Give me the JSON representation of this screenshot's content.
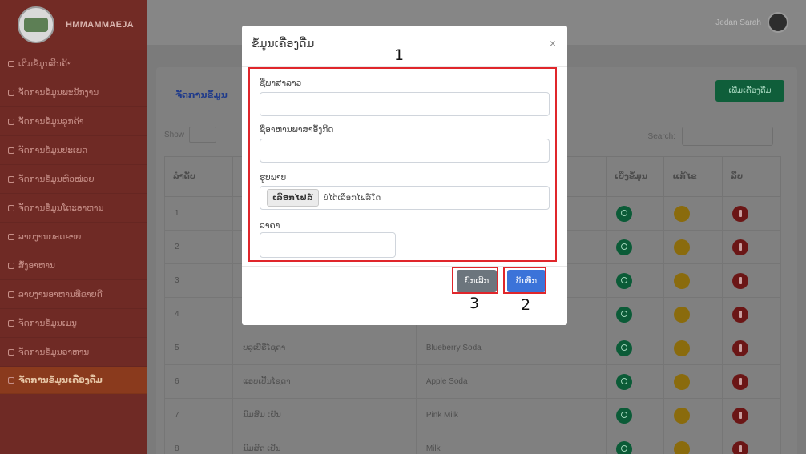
{
  "sidebar": {
    "brand": "HMMAMMAEJA",
    "items": [
      {
        "label": "ເຕີມຂໍ້ມູນສິນຄ້າ",
        "active": false
      },
      {
        "label": "ຈັດການຂໍ້ມູນພະນັກງານ",
        "active": false
      },
      {
        "label": "ຈັດການຂໍ້ມູນລູກຄ້າ",
        "active": false
      },
      {
        "label": "ຈັດການຂໍ້ມູນປະເພດ",
        "active": false
      },
      {
        "label": "ຈັດການຂໍ້ມູນຫົວໜ່ວຍ",
        "active": false
      },
      {
        "label": "ຈັດການຂໍ້ມູນໂຕະອາຫານ",
        "active": false
      },
      {
        "label": "ລາຍງານຍອດຂາຍ",
        "active": false
      },
      {
        "label": "ສັ່ງອາຫານ",
        "active": false
      },
      {
        "label": "ລາຍງານອາຫານທີ່ຂາຍດີ",
        "active": false
      },
      {
        "label": "ຈັດການຂໍ້ມູນເມນູ",
        "active": false
      },
      {
        "label": "ຈັດການຂໍ້ມູນອາຫານ",
        "active": false
      },
      {
        "label": "ຈັດການຂໍ້ມູນເຄື່ອງດື່ມ",
        "active": true
      }
    ]
  },
  "topbar": {
    "user": "Jedan Sarah"
  },
  "card": {
    "title": "ຈັດການຂໍ້ມູນ",
    "add_button": "ເພີ່ມເຄື່ອງດື່ມ",
    "show_label": "Show",
    "show_value": "10",
    "search_label": "Search:",
    "columns": [
      "ລຳດັບ",
      "",
      "",
      "ເບິ່ງຂໍ້ມູນ",
      "ແກ້ໄຂ",
      "ລຶບ"
    ],
    "rows": [
      {
        "no": "1",
        "lao": "",
        "eng": ""
      },
      {
        "no": "2",
        "lao": "",
        "eng": ""
      },
      {
        "no": "3",
        "lao": "",
        "eng": ""
      },
      {
        "no": "4",
        "lao": "",
        "eng": ""
      },
      {
        "no": "5",
        "lao": "ບລູເບີຣີໂຊດາ",
        "eng": "Blueberry Soda"
      },
      {
        "no": "6",
        "lao": "ແອບເປີ້ນໂຊດາ",
        "eng": "Apple Soda"
      },
      {
        "no": "7",
        "lao": "ນົມສົ້ມ ເຢັນ",
        "eng": "Pink Milk"
      },
      {
        "no": "8",
        "lao": "ນົມສົດ ເຢັນ",
        "eng": "Milk"
      }
    ]
  },
  "modal": {
    "title": "ຂໍ້ມູນເຄື່ອງດື່ມ",
    "close": "×",
    "fields": {
      "name_lao": "ຊື່ພາສາລາວ",
      "name_eng": "ຊື່ອາຫານພາສາອັງກິດ",
      "image": "ຮູບພາບ",
      "file_button": "ເລືອກໄຟລ໌",
      "file_text": "ບໍ່ໄດ້ເລືອກໄຟລ໌ໃດ",
      "price": "ລາຄາ"
    },
    "cancel": "ຍົກເລີກ",
    "save": "ບັນທຶກ"
  },
  "annotations": {
    "box1": "1",
    "box2": "2",
    "box3": "3",
    "color": "#e0262b"
  }
}
